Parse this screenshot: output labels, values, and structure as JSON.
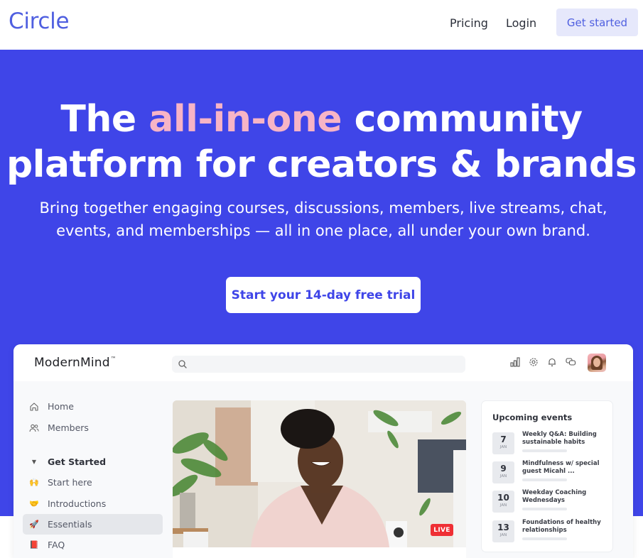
{
  "nav": {
    "logo": "Circle",
    "links": [
      {
        "label": "Pricing"
      },
      {
        "label": "Login"
      }
    ],
    "cta_label": "Get started"
  },
  "hero": {
    "title_part1": "The ",
    "title_accent": "all-in-one",
    "title_part2": " community",
    "title_line2": "platform for creators &  brands",
    "subtitle_line1": "Bring together engaging courses, discussions, members, live streams, chat,",
    "subtitle_line2": "events, and memberships — all in one place, all under your own brand.",
    "cta_label": "Start your 14-day free trial",
    "colors": {
      "background": "#3f45e8",
      "accent": "#f7b4c6"
    }
  },
  "app": {
    "brand": "ModernMind",
    "brand_mark": "™",
    "search_placeholder": "",
    "header_icons": [
      "analytics-icon",
      "settings-icon",
      "notifications-icon",
      "messages-icon"
    ],
    "sidebar": {
      "items": [
        {
          "label": "Home",
          "icon": "home-icon"
        },
        {
          "label": "Members",
          "icon": "members-icon"
        }
      ],
      "section": {
        "label": "Get Started",
        "icon": "caret-down-icon"
      },
      "section_items": [
        {
          "label": "Start here",
          "emoji": "🙌",
          "active": false
        },
        {
          "label": "Introductions",
          "emoji": "🤝",
          "active": false
        },
        {
          "label": "Essentials",
          "emoji": "🚀",
          "active": true
        },
        {
          "label": "FAQ",
          "emoji": "📕",
          "active": false
        }
      ]
    },
    "video": {
      "live_label": "LIVE"
    },
    "events": {
      "title": "Upcoming events",
      "items": [
        {
          "day": "7",
          "month": "JAN",
          "title": "Weekly Q&A: Building sustainable habits"
        },
        {
          "day": "9",
          "month": "JAN",
          "title": "Mindfulness w/ special guest Micahl ..."
        },
        {
          "day": "10",
          "month": "JAN",
          "title": "Weekday Coaching Wednesdays"
        },
        {
          "day": "13",
          "month": "JAN",
          "title": "Foundations of healthy relationships"
        }
      ]
    }
  }
}
